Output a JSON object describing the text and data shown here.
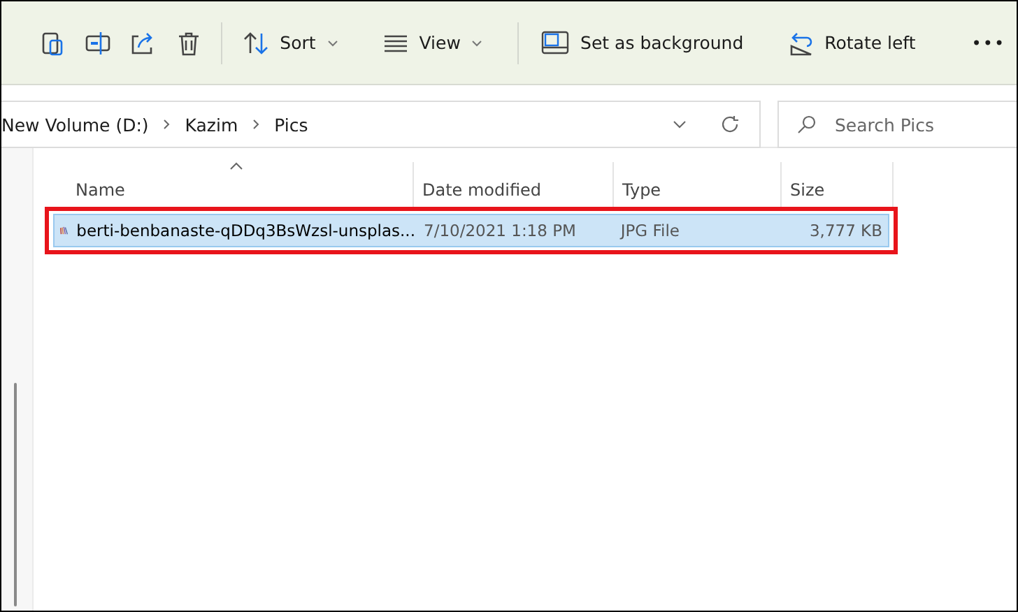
{
  "toolbar": {
    "icon_buttons": [
      {
        "kind": "paste"
      },
      {
        "kind": "rename"
      },
      {
        "kind": "share"
      },
      {
        "kind": "delete"
      }
    ],
    "menus": [
      {
        "kind": "sort",
        "label": "Sort"
      },
      {
        "kind": "view",
        "label": "View"
      }
    ],
    "actions": [
      {
        "kind": "background",
        "label": "Set as background"
      },
      {
        "kind": "rotate",
        "label": "Rotate left"
      }
    ],
    "more": "•••"
  },
  "address": {
    "crumbs": [
      "New Volume (D:)",
      "Kazim",
      "Pics"
    ]
  },
  "search": {
    "placeholder": "Search Pics"
  },
  "table": {
    "columns": [
      {
        "label": "Name",
        "sorted": true
      },
      {
        "label": "Date modified",
        "sorted": false
      },
      {
        "label": "Type",
        "sorted": false
      },
      {
        "label": "Size",
        "sorted": false
      }
    ],
    "rows": [
      {
        "name": "berti-benbanaste-qDDq3BsWzsl-unsplas...",
        "date": "7/10/2021 1:18 PM",
        "type": "JPG File",
        "size": "3,777 KB",
        "selected": true,
        "annotated": true
      }
    ]
  }
}
